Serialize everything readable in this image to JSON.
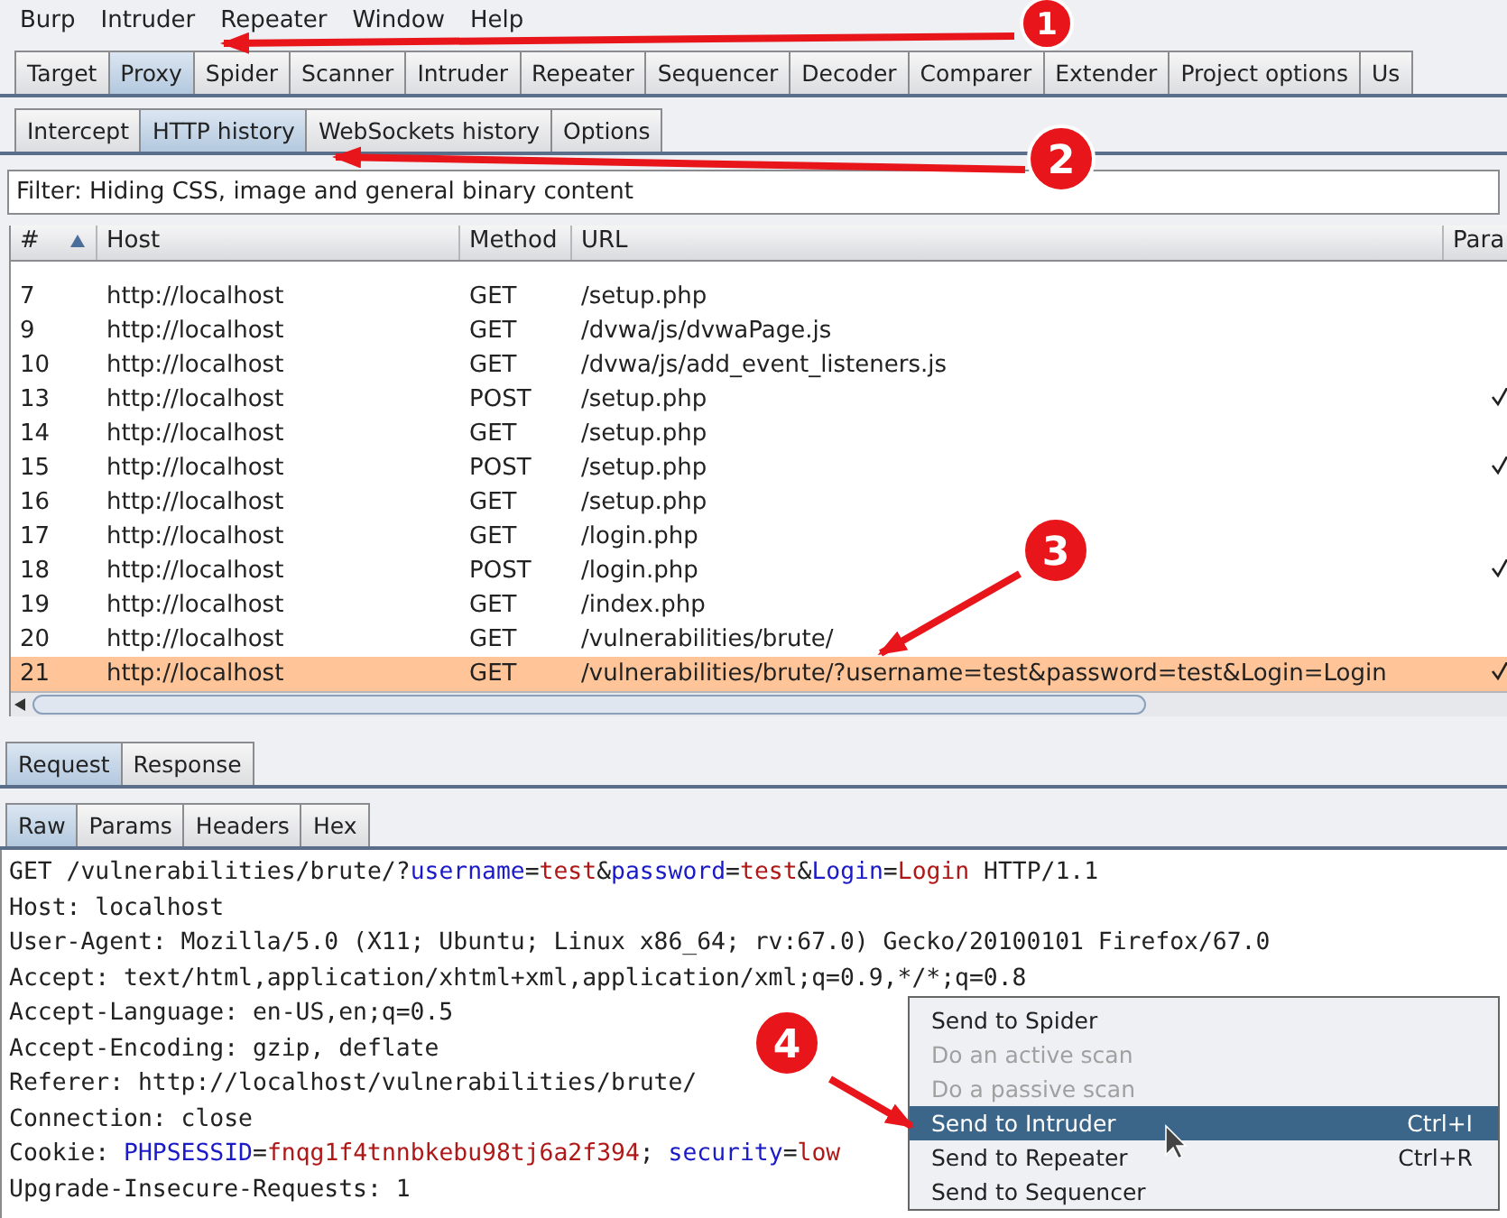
{
  "menu_bar": [
    "Burp",
    "Intruder",
    "Repeater",
    "Window",
    "Help"
  ],
  "tabs": [
    {
      "label": "Target",
      "selected": false
    },
    {
      "label": "Proxy",
      "selected": true
    },
    {
      "label": "Spider",
      "selected": false
    },
    {
      "label": "Scanner",
      "selected": false
    },
    {
      "label": "Intruder",
      "selected": false
    },
    {
      "label": "Repeater",
      "selected": false
    },
    {
      "label": "Sequencer",
      "selected": false
    },
    {
      "label": "Decoder",
      "selected": false
    },
    {
      "label": "Comparer",
      "selected": false
    },
    {
      "label": "Extender",
      "selected": false
    },
    {
      "label": "Project options",
      "selected": false
    },
    {
      "label": "Us",
      "selected": false
    }
  ],
  "sub_tabs": [
    {
      "label": "Intercept",
      "selected": false
    },
    {
      "label": "HTTP history",
      "selected": true
    },
    {
      "label": "WebSockets history",
      "selected": false
    },
    {
      "label": "Options",
      "selected": false
    }
  ],
  "filter": "Filter: Hiding CSS, image and general binary content",
  "table": {
    "columns": [
      "#",
      "Host",
      "Method",
      "URL",
      "Para"
    ],
    "rows": [
      {
        "num": "7",
        "host": "http://localhost",
        "method": "GET",
        "url": "/setup.php",
        "params": false,
        "selected": false
      },
      {
        "num": "9",
        "host": "http://localhost",
        "method": "GET",
        "url": "/dvwa/js/dvwaPage.js",
        "params": false,
        "selected": false
      },
      {
        "num": "10",
        "host": "http://localhost",
        "method": "GET",
        "url": "/dvwa/js/add_event_listeners.js",
        "params": false,
        "selected": false
      },
      {
        "num": "13",
        "host": "http://localhost",
        "method": "POST",
        "url": "/setup.php",
        "params": true,
        "selected": false
      },
      {
        "num": "14",
        "host": "http://localhost",
        "method": "GET",
        "url": "/setup.php",
        "params": false,
        "selected": false
      },
      {
        "num": "15",
        "host": "http://localhost",
        "method": "POST",
        "url": "/setup.php",
        "params": true,
        "selected": false
      },
      {
        "num": "16",
        "host": "http://localhost",
        "method": "GET",
        "url": "/setup.php",
        "params": false,
        "selected": false
      },
      {
        "num": "17",
        "host": "http://localhost",
        "method": "GET",
        "url": "/login.php",
        "params": false,
        "selected": false
      },
      {
        "num": "18",
        "host": "http://localhost",
        "method": "POST",
        "url": "/login.php",
        "params": true,
        "selected": false
      },
      {
        "num": "19",
        "host": "http://localhost",
        "method": "GET",
        "url": "/index.php",
        "params": false,
        "selected": false
      },
      {
        "num": "20",
        "host": "http://localhost",
        "method": "GET",
        "url": "/vulnerabilities/brute/",
        "params": false,
        "selected": false
      },
      {
        "num": "21",
        "host": "http://localhost",
        "method": "GET",
        "url": "/vulnerabilities/brute/?username=test&password=test&Login=Login",
        "params": true,
        "selected": true
      }
    ]
  },
  "message_tabs": [
    {
      "label": "Request",
      "selected": true
    },
    {
      "label": "Response",
      "selected": false
    }
  ],
  "view_tabs": [
    {
      "label": "Raw",
      "selected": true
    },
    {
      "label": "Params",
      "selected": false
    },
    {
      "label": "Headers",
      "selected": false
    },
    {
      "label": "Hex",
      "selected": false
    }
  ],
  "request_lines": [
    [
      {
        "text": "GET /vulnerabilities/brute/?",
        "kind": "plain"
      },
      {
        "text": "username",
        "kind": "name"
      },
      {
        "text": "=",
        "kind": "plain"
      },
      {
        "text": "test",
        "kind": "value"
      },
      {
        "text": "&",
        "kind": "plain"
      },
      {
        "text": "password",
        "kind": "name"
      },
      {
        "text": "=",
        "kind": "plain"
      },
      {
        "text": "test",
        "kind": "value"
      },
      {
        "text": "&",
        "kind": "plain"
      },
      {
        "text": "Login",
        "kind": "name"
      },
      {
        "text": "=",
        "kind": "plain"
      },
      {
        "text": "Login",
        "kind": "value"
      },
      {
        "text": " HTTP/1.1",
        "kind": "plain"
      }
    ],
    [
      {
        "text": "Host: localhost",
        "kind": "plain"
      }
    ],
    [
      {
        "text": "User-Agent: Mozilla/5.0 (X11; Ubuntu; Linux x86_64; rv:67.0) Gecko/20100101 Firefox/67.0",
        "kind": "plain"
      }
    ],
    [
      {
        "text": "Accept: text/html,application/xhtml+xml,application/xml;q=0.9,*/*;q=0.8",
        "kind": "plain"
      }
    ],
    [
      {
        "text": "Accept-Language: en-US,en;q=0.5",
        "kind": "plain"
      }
    ],
    [
      {
        "text": "Accept-Encoding: gzip, deflate",
        "kind": "plain"
      }
    ],
    [
      {
        "text": "Referer: http://localhost/vulnerabilities/brute/",
        "kind": "plain"
      }
    ],
    [
      {
        "text": "Connection: close",
        "kind": "plain"
      }
    ],
    [
      {
        "text": "Cookie: ",
        "kind": "plain"
      },
      {
        "text": "PHPSESSID",
        "kind": "name"
      },
      {
        "text": "=",
        "kind": "plain"
      },
      {
        "text": "fnqg1f4tnnbkebu98tj6a2f394",
        "kind": "value"
      },
      {
        "text": "; ",
        "kind": "plain"
      },
      {
        "text": "security",
        "kind": "name"
      },
      {
        "text": "=",
        "kind": "plain"
      },
      {
        "text": "low",
        "kind": "value"
      }
    ],
    [
      {
        "text": "Upgrade-Insecure-Requests: 1",
        "kind": "plain"
      }
    ]
  ],
  "context_menu": [
    {
      "label": "Send to Spider",
      "disabled": false,
      "selected": false
    },
    {
      "label": "Do an active scan",
      "disabled": true,
      "selected": false
    },
    {
      "label": "Do a passive scan",
      "disabled": true,
      "selected": false
    },
    {
      "label": "Send to Intruder",
      "shortcut": "Ctrl+I",
      "disabled": false,
      "selected": true
    },
    {
      "label": "Send to Repeater",
      "shortcut": "Ctrl+R",
      "disabled": false,
      "selected": false
    },
    {
      "label": "Send to Sequencer",
      "disabled": false,
      "selected": false
    }
  ],
  "annotations": [
    "1",
    "2",
    "3",
    "4"
  ]
}
